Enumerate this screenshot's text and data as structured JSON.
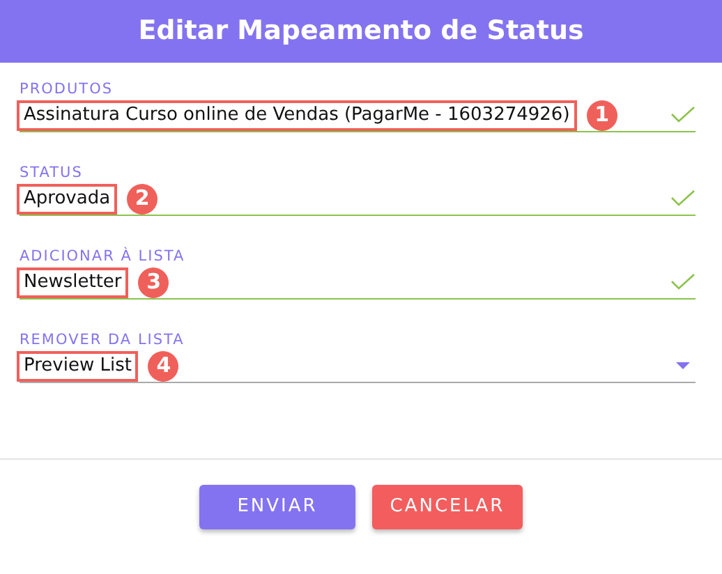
{
  "dialog": {
    "title": "Editar Mapeamento de Status"
  },
  "fields": [
    {
      "label": "PRODUTOS",
      "value": "Assinatura Curso online de Vendas (PagarMe - 1603274926)",
      "kind": "valid",
      "callout": "1"
    },
    {
      "label": "STATUS",
      "value": "Aprovada",
      "kind": "valid",
      "callout": "2"
    },
    {
      "label": "ADICIONAR À LISTA",
      "value": "Newsletter",
      "kind": "valid",
      "callout": "3"
    },
    {
      "label": "REMOVER DA LISTA",
      "value": "Preview List",
      "kind": "select",
      "callout": "4"
    }
  ],
  "buttons": [
    {
      "label": "ENVIAR",
      "kind": "primary"
    },
    {
      "label": "CANCELAR",
      "kind": "danger"
    }
  ]
}
